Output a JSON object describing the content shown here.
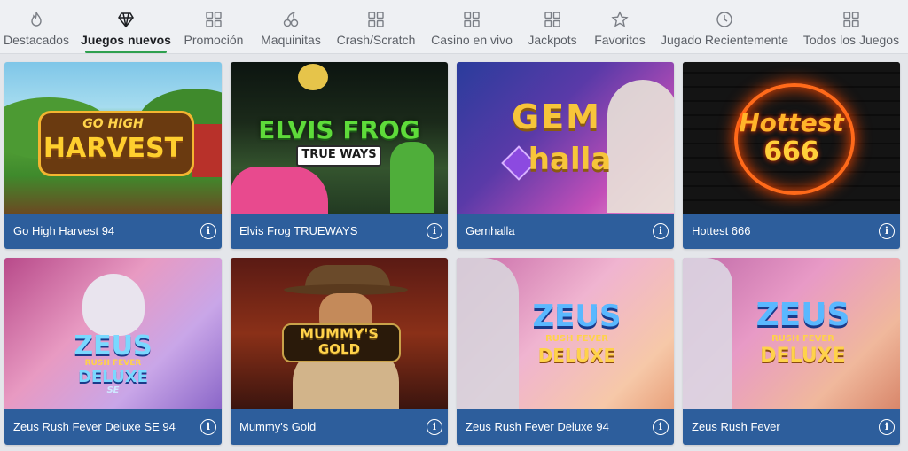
{
  "nav": {
    "items": [
      {
        "label": "Destacados",
        "icon": "flame-icon"
      },
      {
        "label": "Juegos nuevos",
        "icon": "diamond-icon",
        "active": true
      },
      {
        "label": "Promoción",
        "icon": "grid-icon"
      },
      {
        "label": "Maquinitas",
        "icon": "cherries-icon"
      },
      {
        "label": "Crash/Scratch",
        "icon": "grid-icon"
      },
      {
        "label": "Casino en vivo",
        "icon": "grid-icon"
      },
      {
        "label": "Jackpots",
        "icon": "grid-icon"
      },
      {
        "label": "Favoritos",
        "icon": "star-icon"
      },
      {
        "label": "Jugado Recientemente",
        "icon": "clock-icon"
      },
      {
        "label": "Todos los Juegos",
        "icon": "grid-icon"
      }
    ],
    "active_color": "#2ea04f"
  },
  "games": [
    {
      "title": "Go High Harvest 94",
      "logo_lines": [
        "GO HIGH",
        "HARVEST"
      ]
    },
    {
      "title": "Elvis Frog TRUEWAYS",
      "logo_lines": [
        "ELVIS FROG",
        "TRUE WAYS"
      ]
    },
    {
      "title": "Gemhalla",
      "logo_lines": [
        "GEM",
        "halla"
      ]
    },
    {
      "title": "Hottest 666",
      "logo_lines": [
        "Hottest",
        "666"
      ]
    },
    {
      "title": "Zeus Rush Fever Deluxe SE 94",
      "logo_lines": [
        "ZEUS",
        "RUSH FEVER",
        "DELUXE",
        "SE"
      ]
    },
    {
      "title": "Mummy's Gold",
      "logo_lines": [
        "MUMMY'S",
        "GOLD"
      ]
    },
    {
      "title": "Zeus Rush Fever Deluxe 94",
      "logo_lines": [
        "ZEUS",
        "RUSH FEVER",
        "DELUXE"
      ]
    },
    {
      "title": "Zeus Rush Fever",
      "logo_lines": [
        "ZEUS",
        "RUSH FEVER",
        "DELUXE"
      ]
    }
  ],
  "info_glyph": "i",
  "caption_color": "#2d5e9c"
}
